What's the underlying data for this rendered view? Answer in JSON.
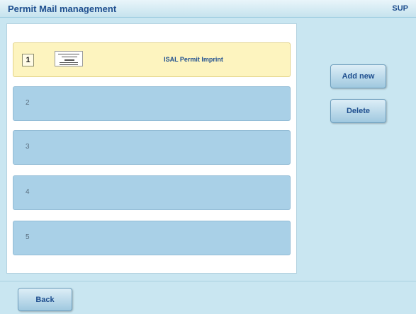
{
  "header": {
    "title": "Permit Mail management",
    "mode": "SUP"
  },
  "slots": [
    {
      "number": "1",
      "label": "ISAL Permit Imprint",
      "selected": true
    },
    {
      "number": "2",
      "label": ""
    },
    {
      "number": "3",
      "label": ""
    },
    {
      "number": "4",
      "label": ""
    },
    {
      "number": "5",
      "label": ""
    }
  ],
  "actions": {
    "add_label": "Add new",
    "delete_label": "Delete"
  },
  "footer": {
    "back_label": "Back"
  },
  "colors": {
    "title_text": "#1f4f8f",
    "selected_slot": "#fdf4bf",
    "empty_slot": "#a9d0e7",
    "background": "#c9e6f1"
  }
}
